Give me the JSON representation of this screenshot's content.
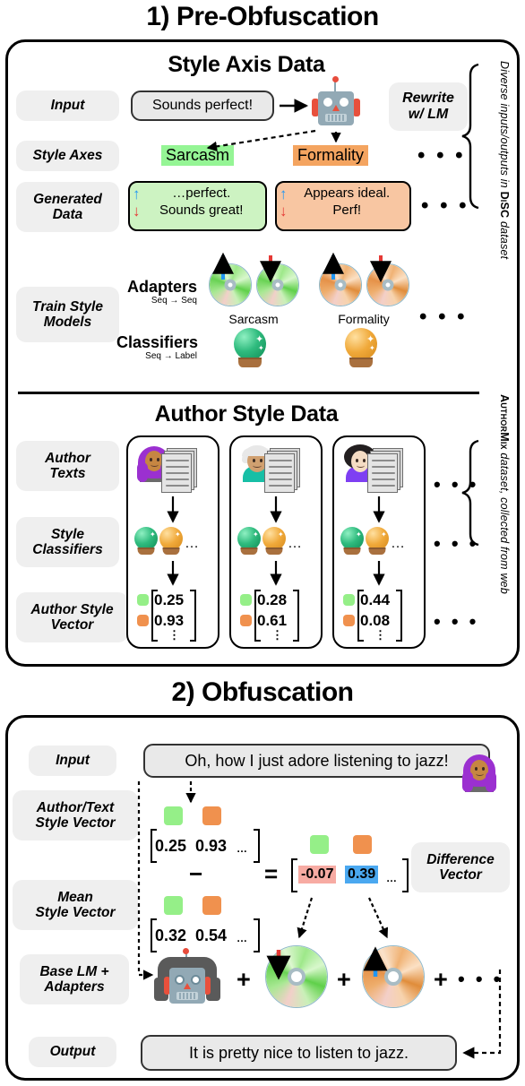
{
  "figure": {
    "section1_title": "1) Pre-Obfuscation",
    "section2_title": "2) Obfuscation"
  },
  "pre_obfuscation": {
    "style_axis_block": {
      "title": "Style Axis Data",
      "row_labels": {
        "input": "Input",
        "style_axes": "Style Axes",
        "generated_data": "Generated\nData",
        "train_style_models": "Train Style\nModels"
      },
      "input_text": "Sounds perfect!",
      "rewrite_note": "Rewrite\nw/ LM",
      "axes": [
        {
          "name": "Sarcasm",
          "color": "#95f595"
        },
        {
          "name": "Formality",
          "color": "#f4a460"
        }
      ],
      "axes_ellipsis": "• • •",
      "generated": [
        {
          "axis": "Sarcasm",
          "color": "#cdf3c2",
          "up_text": "…perfect.",
          "down_text": "Sounds great!",
          "up_arrow": "up-arrow-icon",
          "down_arrow": "down-arrow-icon"
        },
        {
          "axis": "Formality",
          "color": "#f8c6a2",
          "up_text": "Appears ideal.",
          "down_text": "Perf!",
          "up_arrow": "up-arrow-icon",
          "down_arrow": "down-arrow-icon"
        }
      ],
      "generated_ellipsis": "• • •",
      "adapters_label": "Adapters",
      "adapters_sublabel": "Seq → Seq",
      "classifiers_label": "Classifiers",
      "classifiers_sublabel": "Seq → Label",
      "adapter_groups": [
        {
          "name": "Sarcasm",
          "disc_color": "green"
        },
        {
          "name": "Formality",
          "disc_color": "orange"
        }
      ],
      "models_ellipsis": "• • •",
      "side_annotation": {
        "prefix": "Diverse inputs/outputs in ",
        "bold": "DiSC",
        "suffix": " dataset"
      }
    },
    "author_style_block": {
      "title": "Author Style Data",
      "row_labels": {
        "author_texts": "Author\nTexts",
        "style_classifiers": "Style\nClassifiers",
        "author_style_vector": "Author Style\nVector"
      },
      "authors": [
        {
          "avatar": "woman-with-headscarf-avatar",
          "classifier_ellipsis": "…",
          "vector": [
            "0.25",
            "0.93"
          ],
          "vdots": "⋮"
        },
        {
          "avatar": "older-person-avatar",
          "classifier_ellipsis": "…",
          "vector": [
            "0.28",
            "0.61"
          ],
          "vdots": "⋮"
        },
        {
          "avatar": "person-curly-hair-avatar",
          "classifier_ellipsis": "…",
          "vector": [
            "0.44",
            "0.08"
          ],
          "vdots": "⋮"
        }
      ],
      "authors_ellipsis": "• • •",
      "classifiers_ellipsis": "• • •",
      "vectors_ellipsis": "• • •",
      "side_annotation": {
        "bold": "AuthorMix",
        "suffix": " dataset, collected from web"
      }
    }
  },
  "obfuscation": {
    "row_labels": {
      "input": "Input",
      "author_text_style_vector": "Author/Text\nStyle Vector",
      "mean_style_vector": "Mean\nStyle Vector",
      "base_lm_adapters": "Base LM +\nAdapters",
      "output": "Output"
    },
    "input_text": "Oh, how I just adore listening to jazz!",
    "author_avatar": "woman-with-headscarf-avatar",
    "author_vector": [
      "0.25",
      "0.93",
      "…"
    ],
    "mean_vector": [
      "0.32",
      "0.54",
      "…"
    ],
    "minus_symbol": "−",
    "equals_symbol": "=",
    "difference_vector": [
      "-0.07",
      "0.39",
      "…"
    ],
    "difference_label": "Difference\nVector",
    "difference_colors": {
      "first": "#f7aba3",
      "second": "#4aa8f0"
    },
    "plus_symbol": "+",
    "trailing_ellipsis": "• • •",
    "adapters": [
      {
        "disc_color": "green",
        "arrow": "down-arrow-icon"
      },
      {
        "disc_color": "orange",
        "arrow": "up-arrow-icon"
      }
    ],
    "base_lm_icon": "robot-with-headphones-icon",
    "output_text": "It is pretty nice to listen to jazz."
  },
  "colors": {
    "green_highlight": "#95f595",
    "orange_highlight": "#f4a460",
    "green_box": "#cdf3c2",
    "orange_box": "#f8c6a2",
    "blue_arrow": "#2196f3",
    "red_arrow": "#e53935",
    "pill_bg": "#efefef",
    "bubble_bg": "#e9e9e9"
  }
}
